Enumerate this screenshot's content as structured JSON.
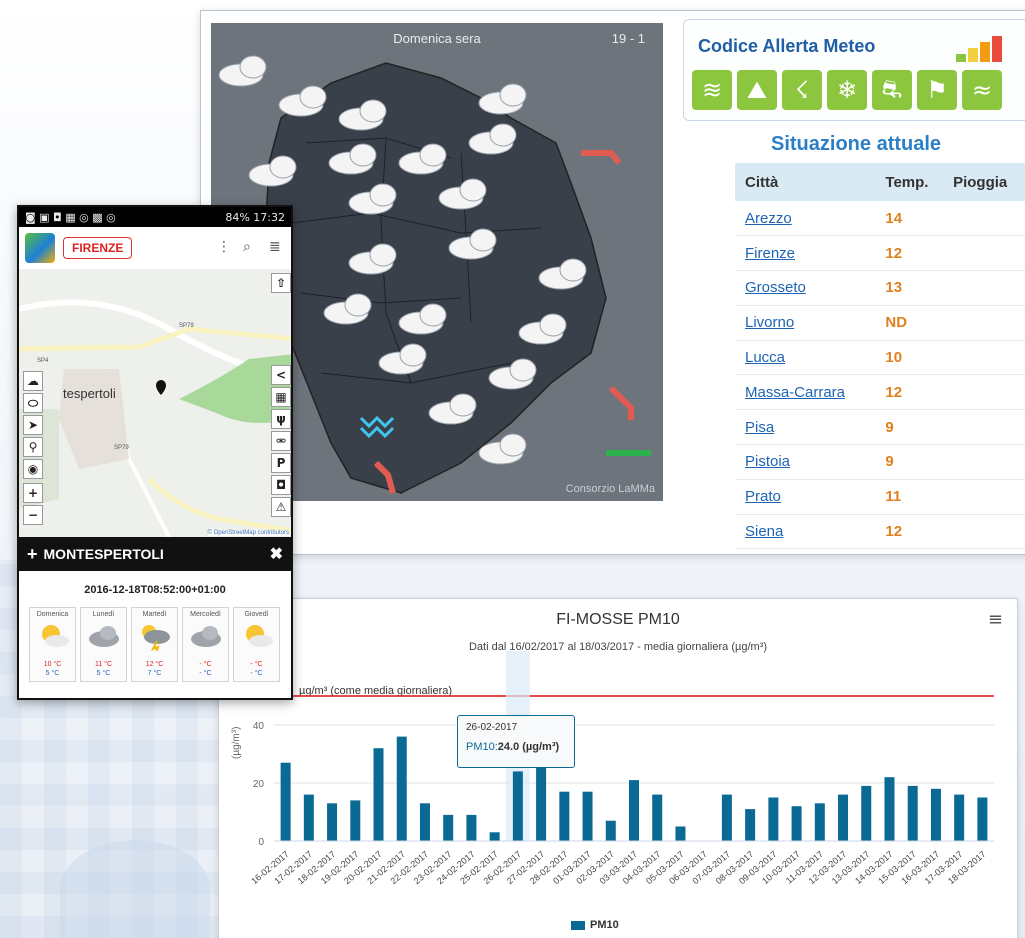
{
  "weather_map": {
    "title": "Domenica sera",
    "date": "19 - 1",
    "credit": "Consorzio LaMMa"
  },
  "alert": {
    "title": "Codice Allerta Meteo",
    "level_colors": [
      "#8cc63f",
      "#f4d03f",
      "#f39c12",
      "#e74c3c"
    ],
    "icons": [
      "flood-icon",
      "landslide-icon",
      "storm-icon",
      "snow-icon",
      "ice-icon",
      "wind-icon",
      "sea-icon"
    ]
  },
  "situation": {
    "title": "Situazione attuale",
    "headers": [
      "Città",
      "Temp.",
      "Pioggia"
    ],
    "rows": [
      {
        "city": "Arezzo",
        "temp": "14"
      },
      {
        "city": "Firenze",
        "temp": "12"
      },
      {
        "city": "Grosseto",
        "temp": "13"
      },
      {
        "city": "Livorno",
        "temp": "ND"
      },
      {
        "city": "Lucca",
        "temp": "10"
      },
      {
        "city": "Massa-Carrara",
        "temp": "12"
      },
      {
        "city": "Pisa",
        "temp": "9"
      },
      {
        "city": "Pistoia",
        "temp": "9"
      },
      {
        "city": "Prato",
        "temp": "11"
      },
      {
        "city": "Siena",
        "temp": "12"
      }
    ]
  },
  "phone": {
    "status_right": "84% 17:32",
    "city": "FIRENZE",
    "place_label": "tespertoli",
    "road_labels": [
      "SP79",
      "SP4",
      "SP79"
    ],
    "osm_credit": "© OpenStreetMap contributors",
    "location_title": "MONTESPERTOLI",
    "datetime": "2016-12-18T08:52:00+01:00",
    "days": [
      {
        "name": "Domenica",
        "icon": "sun-cloud-icon",
        "max": "10 °C",
        "min": "5 °C"
      },
      {
        "name": "Lunedì",
        "icon": "cloud-icon",
        "max": "11 °C",
        "min": "5 °C"
      },
      {
        "name": "Martedì",
        "icon": "thunderstorm-icon",
        "max": "12 °C",
        "min": "7 °C"
      },
      {
        "name": "Mercoledì",
        "icon": "cloud-icon",
        "max": "- °C",
        "min": "- °C"
      },
      {
        "name": "Giovedì",
        "icon": "sun-cloud-icon",
        "max": "- °C",
        "min": "- °C"
      }
    ]
  },
  "chart_data": {
    "type": "bar",
    "title": "FI-MOSSE PM10",
    "subtitle": "Dati dal 16/02/2017 al 18/03/2017 - media giornaliera (µg/m³)",
    "ylabel": "(µg/m³)",
    "ylim": [
      0,
      45
    ],
    "yticks": [
      0,
      20,
      40
    ],
    "limit_line": {
      "value": 50,
      "label": "µg/m³ (come media giornaliera)"
    },
    "categories": [
      "16-02-2017",
      "17-02-2017",
      "18-02-2017",
      "19-02-2017",
      "20-02-2017",
      "21-02-2017",
      "22-02-2017",
      "23-02-2017",
      "24-02-2017",
      "25-02-2017",
      "26-02-2017",
      "27-02-2017",
      "28-02-2017",
      "01-03-2017",
      "02-03-2017",
      "03-03-2017",
      "04-03-2017",
      "05-03-2017",
      "06-03-2017",
      "07-03-2017",
      "08-03-2017",
      "09-03-2017",
      "10-03-2017",
      "11-03-2017",
      "12-03-2017",
      "13-03-2017",
      "14-03-2017",
      "15-03-2017",
      "16-03-2017",
      "17-03-2017",
      "18-03-2017"
    ],
    "series": [
      {
        "name": "PM10",
        "values": [
          27,
          16,
          13,
          14,
          32,
          36,
          13,
          9,
          9,
          3,
          24,
          29,
          17,
          17,
          7,
          21,
          16,
          5,
          0,
          16,
          11,
          15,
          12,
          13,
          16,
          19,
          22,
          19,
          18,
          16,
          15
        ]
      }
    ],
    "tooltip": {
      "date": "26-02-2017",
      "label": "PM10:",
      "value": "24.0 (µg/m³)"
    },
    "legend": "PM10",
    "color": "#0b6a93",
    "limit_color": "#d11"
  }
}
